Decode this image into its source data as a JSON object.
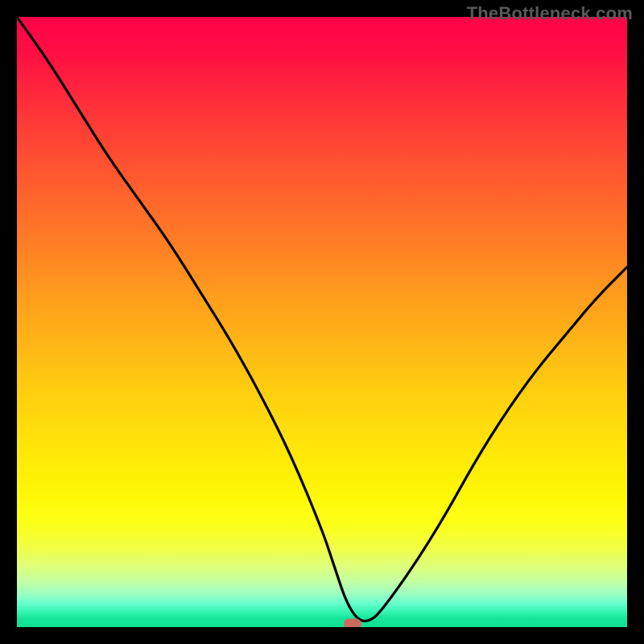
{
  "watermark": "TheBottleneck.com",
  "colors": {
    "frame_bg": "#000000",
    "curve_stroke": "#000000",
    "marker_fill": "#cc6a62",
    "watermark_color": "#585858"
  },
  "chart_data": {
    "type": "line",
    "title": "",
    "xlabel": "",
    "ylabel": "",
    "xlim": [
      0,
      100
    ],
    "ylim": [
      0,
      100
    ],
    "grid": false,
    "series": [
      {
        "name": "bottleneck-curve",
        "x": [
          0,
          5,
          10,
          15,
          20,
          25,
          30,
          35,
          40,
          45,
          50,
          52,
          54,
          56,
          58,
          60,
          65,
          70,
          75,
          80,
          85,
          90,
          95,
          100
        ],
        "values": [
          100,
          93,
          85,
          77,
          70,
          63,
          55,
          47,
          38,
          28,
          16,
          10,
          4,
          1,
          1,
          3,
          10,
          18,
          27,
          35,
          42,
          48,
          54,
          59
        ]
      }
    ],
    "marker": {
      "x": 55,
      "y": 0.5
    },
    "gradient_stops": [
      {
        "pos": 0.0,
        "color": "#ff0248"
      },
      {
        "pos": 0.25,
        "color": "#ff5530"
      },
      {
        "pos": 0.5,
        "color": "#ffa41a"
      },
      {
        "pos": 0.78,
        "color": "#fff705"
      },
      {
        "pos": 0.92,
        "color": "#c4ffa3"
      },
      {
        "pos": 1.0,
        "color": "#0ee091"
      }
    ]
  }
}
